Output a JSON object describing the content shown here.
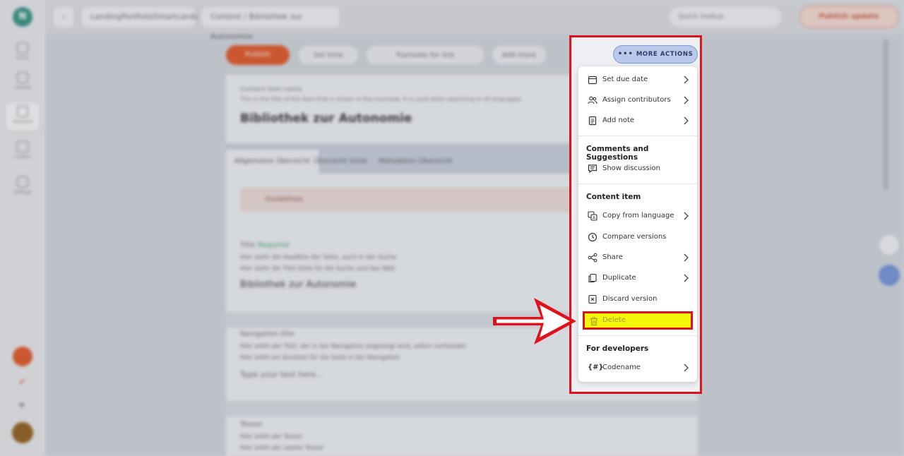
{
  "sidebar": {
    "logo_letter": "N",
    "items": [
      {
        "label": "Home"
      },
      {
        "label": "Content"
      },
      {
        "label": "Structure"
      },
      {
        "label": "Custom"
      },
      {
        "label": "Settings"
      }
    ]
  },
  "topbar": {
    "back": "‹",
    "project": "LandingPortfolioSmartcards",
    "path": "Content / Bibliothek zur Autonomie",
    "search_placeholder": "Quick lookup",
    "publish": "Publish update"
  },
  "content": {
    "primary_action": "Publish",
    "actions": [
      "Set time",
      "Translate for link",
      "Add more"
    ],
    "header_label": "Content item name",
    "header_desc": "This is the title of the item that is shown in the overview. It is used when searching in all languages.",
    "title": "Bibliothek zur Autonomie",
    "tabs": [
      "Allgemeine Übersicht",
      "Übersicht Seite",
      "Metadaten Übersicht"
    ],
    "warning": "Guidelines",
    "fields": [
      {
        "label": "Title",
        "status": "Required",
        "line1": "Hier steht die Headline der Seite, auch in der Suche",
        "line2": "Hier steht die Titel-Zeile für die Suche und das Web",
        "value": "Bibliothek zur Autonomie"
      },
      {
        "label": "Navigation title",
        "line1": "Hier steht der Titel, der in der Navigation angezeigt wird, sofern vorhanden",
        "line2": "Hier steht ein Kurztext für die Seite in der Navigation",
        "value": "Type your text here..."
      },
      {
        "label": "Teaser",
        "line1": "Hier steht der Teaser",
        "line2": "Hier steht der zweite Teaser"
      }
    ]
  },
  "more_actions": {
    "label": "MORE ACTIONS",
    "menu": {
      "group1": [
        {
          "label": "Set due date",
          "icon": "calendar-icon",
          "submenu": true
        },
        {
          "label": "Assign contributors",
          "icon": "people-icon",
          "submenu": true
        },
        {
          "label": "Add note",
          "icon": "note-icon",
          "submenu": true
        }
      ],
      "comments_heading": "Comments and Suggestions",
      "comments": [
        {
          "label": "Show discussion",
          "icon": "chat-icon",
          "submenu": false
        }
      ],
      "content_heading": "Content item",
      "content_items": [
        {
          "label": "Copy from language",
          "icon": "language-icon",
          "submenu": true
        },
        {
          "label": "Compare versions",
          "icon": "clock-icon",
          "submenu": false
        },
        {
          "label": "Share",
          "icon": "share-icon",
          "submenu": true
        },
        {
          "label": "Duplicate",
          "icon": "duplicate-icon",
          "submenu": true
        },
        {
          "label": "Discard version",
          "icon": "discard-icon",
          "submenu": false
        }
      ],
      "delete_label": "Delete",
      "dev_heading": "For developers",
      "dev_items": [
        {
          "label": "Codename",
          "icon": "codename-icon",
          "submenu": true
        }
      ]
    }
  },
  "colors": {
    "highlight_border": "#e0111a",
    "highlight_fill": "#f5f50a",
    "accent": "#e0511f"
  }
}
